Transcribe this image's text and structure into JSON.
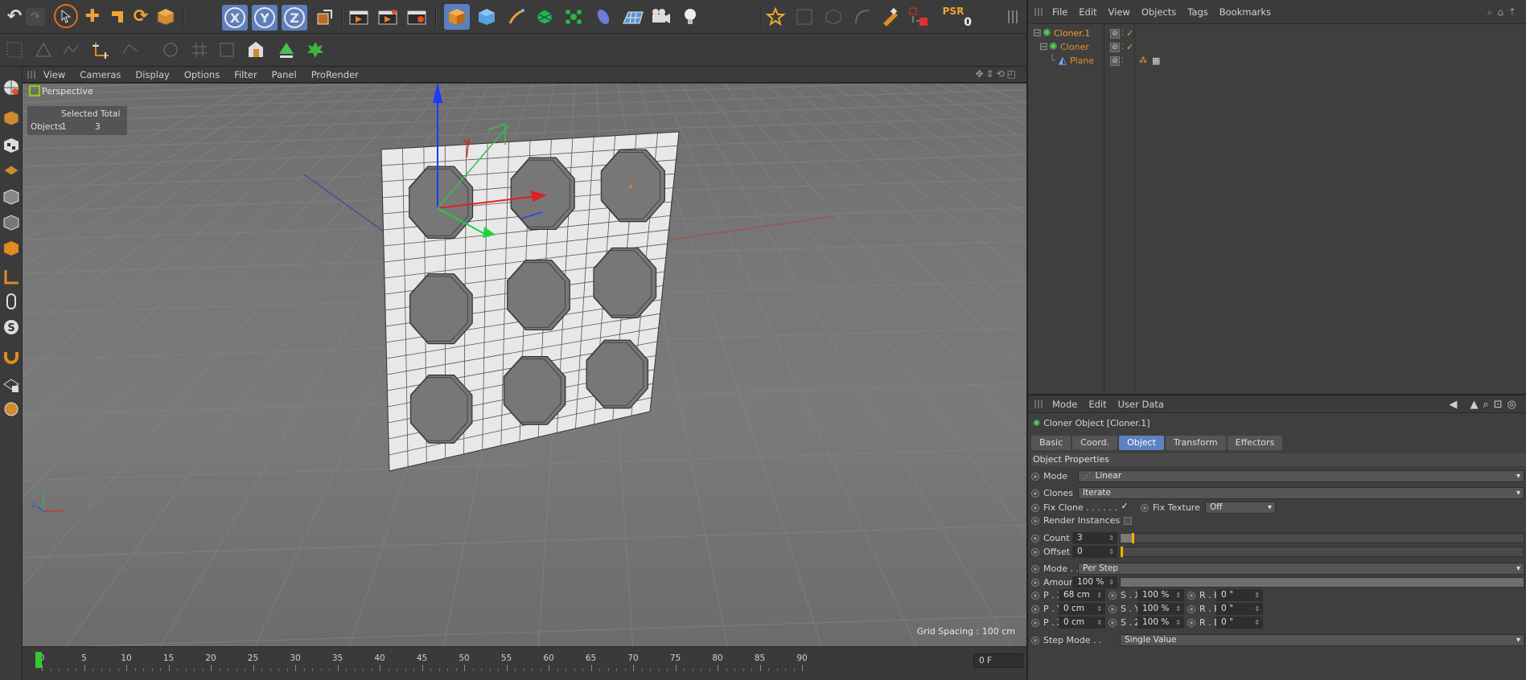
{
  "colors": {
    "accent": "#5d82c1",
    "object_name": "#ff9d2e",
    "playhead": "#35c92f",
    "slider_knob": "#ffb000",
    "axis_x": "#e02020",
    "axis_y": "#2ec24a",
    "axis_z": "#1a3cff"
  },
  "toolbar": {
    "axis_x": "X",
    "axis_y": "Y",
    "axis_z": "Z",
    "psr_label": "PSR",
    "psr_value": "0",
    "icons": [
      "undo-icon",
      "redo-icon",
      "live-select-icon",
      "move-icon",
      "scale-icon",
      "rotate-icon",
      "model-mode-icon",
      "coord-system-icon",
      "render-view-icon",
      "render-picture-viewer-icon",
      "render-settings-icon",
      "cube-icon",
      "sphere-icon",
      "pen-icon",
      "subdivision-icon",
      "mograph-icon",
      "deformer-icon",
      "floor-icon",
      "camera-icon",
      "light-icon",
      "snap-icon",
      "workplane-icon",
      "selection-tool-icon"
    ]
  },
  "viewport_menu": {
    "items": [
      "View",
      "Cameras",
      "Display",
      "Options",
      "Filter",
      "Panel",
      "ProRender"
    ]
  },
  "viewport": {
    "label": "Perspective",
    "label_box": "Pe",
    "label_rest": "rspective",
    "hud": {
      "header": "Selected Total",
      "row_label": "Objects",
      "selected": "1",
      "total": "3"
    },
    "grid_spacing": "Grid Spacing : 100 cm"
  },
  "timeline": {
    "ticks": [
      "0",
      "5",
      "10",
      "15",
      "20",
      "25",
      "30",
      "35",
      "40",
      "45",
      "50",
      "55",
      "60",
      "65",
      "70",
      "75",
      "80",
      "85",
      "90"
    ],
    "current_frame": "0 F"
  },
  "object_manager": {
    "menu": [
      "File",
      "Edit",
      "View",
      "Objects",
      "Tags",
      "Bookmarks"
    ],
    "objects": [
      {
        "name": "Cloner.1",
        "indent": 0
      },
      {
        "name": "Cloner",
        "indent": 1
      },
      {
        "name": "Plane",
        "indent": 2
      }
    ]
  },
  "attribute_manager": {
    "menu": [
      "Mode",
      "Edit",
      "User Data"
    ],
    "title": "Cloner Object [Cloner.1]",
    "tabs": [
      "Basic",
      "Coord.",
      "Object",
      "Transform",
      "Effectors"
    ],
    "active_tab": "Object",
    "section": "Object Properties",
    "mode_label": "Mode",
    "mode_value": "Linear",
    "clones_label": "Clones",
    "clones_value": "Iterate",
    "fix_clone_label": "Fix Clone . . . . . .",
    "fix_clone_checked": "✓",
    "fix_texture_label": "Fix Texture",
    "fix_texture_value": "Off",
    "render_instances_label": "Render Instances",
    "count_label": "Count",
    "count_value": "3",
    "count_slider_fraction": 0.015,
    "offset_label": "Offset",
    "offset_value": "0",
    "mode2_label": "Mode . .",
    "mode2_value": "Per Step",
    "amount_label": "Amount",
    "amount_value": "100 %",
    "px_label": "P . X",
    "px_value": "68 cm",
    "py_label": "P . Y",
    "py_value": "0 cm",
    "pz_label": "P . Z",
    "pz_value": "0 cm",
    "sx_label": "S . X",
    "sx_value": "100 %",
    "sy_label": "S . Y",
    "sy_value": "100 %",
    "sz_label": "S . Z",
    "sz_value": "100 %",
    "rh_label": "R . H",
    "rh_value": "0 °",
    "rp_label": "R . P",
    "rp_value": "0 °",
    "rb_label": "R . B",
    "rb_value": "0 °",
    "step_mode_label": "Step Mode . .",
    "step_mode_value": "Single Value"
  }
}
